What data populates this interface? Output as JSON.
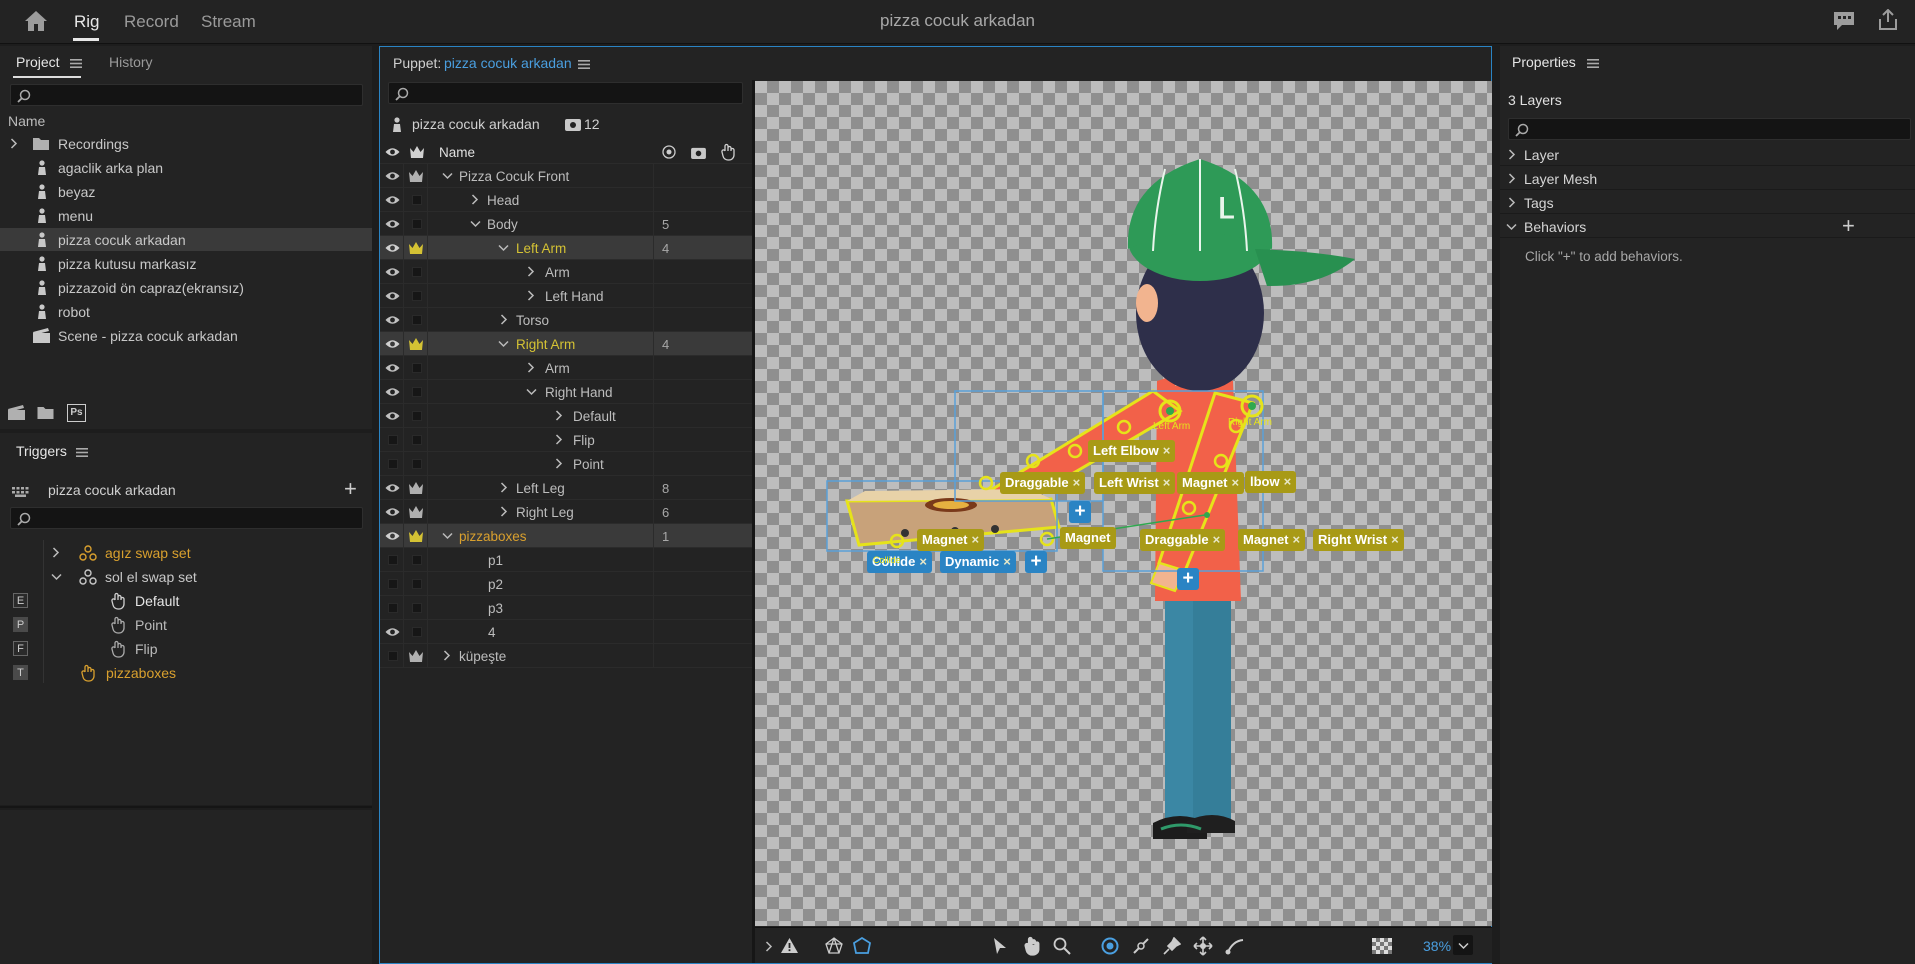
{
  "topbar": {
    "tabs": [
      "Rig",
      "Record",
      "Stream"
    ],
    "title": "pizza cocuk arkadan"
  },
  "project": {
    "tabs": [
      "Project",
      "History"
    ],
    "column_header": "Name",
    "items": [
      {
        "label": "Recordings",
        "icon": "folder-icon"
      },
      {
        "label": "agaclik arka plan",
        "icon": "puppet-icon"
      },
      {
        "label": "beyaz",
        "icon": "puppet-icon"
      },
      {
        "label": "menu",
        "icon": "puppet-icon"
      },
      {
        "label": "pizza cocuk arkadan",
        "icon": "puppet-icon"
      },
      {
        "label": "pizza kutusu markasız",
        "icon": "puppet-icon"
      },
      {
        "label": "pizzazoid ön capraz(ekransız)",
        "icon": "puppet-icon"
      },
      {
        "label": "robot",
        "icon": "puppet-icon"
      },
      {
        "label": "Scene - pizza cocuk arkadan",
        "icon": "scene-icon"
      }
    ],
    "ps_label": "Ps"
  },
  "triggers": {
    "title": "Triggers",
    "puppet": "pizza cocuk arkadan",
    "items": [
      {
        "key": "",
        "label": "agız swap set"
      },
      {
        "key": "",
        "label": "sol el swap set"
      },
      {
        "key": "E",
        "label": "Default"
      },
      {
        "key": "P",
        "label": "Point"
      },
      {
        "key": "F",
        "label": "Flip"
      },
      {
        "key": "T",
        "label": "pizzaboxes"
      }
    ]
  },
  "puppet": {
    "title_prefix": "Puppet:",
    "title_name": "pizza cocuk arkadan",
    "root_name": "pizza cocuk arkadan",
    "count": "12",
    "column_header": "Name",
    "rows": [
      {
        "name": "Pizza Cocuk Front",
        "count": ""
      },
      {
        "name": "Head",
        "count": ""
      },
      {
        "name": "Body",
        "count": "5"
      },
      {
        "name": "Left Arm",
        "count": "4"
      },
      {
        "name": "Arm",
        "count": ""
      },
      {
        "name": "Left Hand",
        "count": ""
      },
      {
        "name": "Torso",
        "count": ""
      },
      {
        "name": "Right Arm",
        "count": "4"
      },
      {
        "name": "Arm",
        "count": ""
      },
      {
        "name": "Right Hand",
        "count": ""
      },
      {
        "name": "Default",
        "count": ""
      },
      {
        "name": "Flip",
        "count": ""
      },
      {
        "name": "Point",
        "count": ""
      },
      {
        "name": "Left Leg",
        "count": "8"
      },
      {
        "name": "Right Leg",
        "count": "6"
      },
      {
        "name": "pizzaboxes",
        "count": "1"
      },
      {
        "name": "p1",
        "count": ""
      },
      {
        "name": "p2",
        "count": ""
      },
      {
        "name": "p3",
        "count": ""
      },
      {
        "name": "4",
        "count": ""
      },
      {
        "name": "küpeşte",
        "count": ""
      }
    ]
  },
  "canvas": {
    "labels": {
      "left_arm": "Left Arm",
      "right_arm": "Right Arm",
      "collide": "Collide",
      "logo": "Ⅼ"
    },
    "tags": {
      "left_elbow": "Left Elbow",
      "draggable1": "Draggable",
      "left_wrist": "Left Wrist",
      "magnet1": "Magnet",
      "elbow": "lbow",
      "magnet2": "Magnet",
      "magnet3": "Magnet",
      "draggable2": "Draggable",
      "magnet4": "Magnet",
      "right_wrist": "Right Wrist",
      "collide_tag": "Collide",
      "dynamic": "Dynamic",
      "close": "×"
    },
    "zoom": "38%"
  },
  "properties": {
    "title": "Properties",
    "layers": "3 Layers",
    "sections": [
      "Layer",
      "Layer Mesh",
      "Tags",
      "Behaviors"
    ],
    "hint": "Click \"+\" to add behaviors."
  },
  "colors": {
    "accent_blue": "#2a84c4",
    "handle_yellow": "#e6e31a",
    "tag_yellow": "#a89a16",
    "orange": "#d9a02e"
  }
}
